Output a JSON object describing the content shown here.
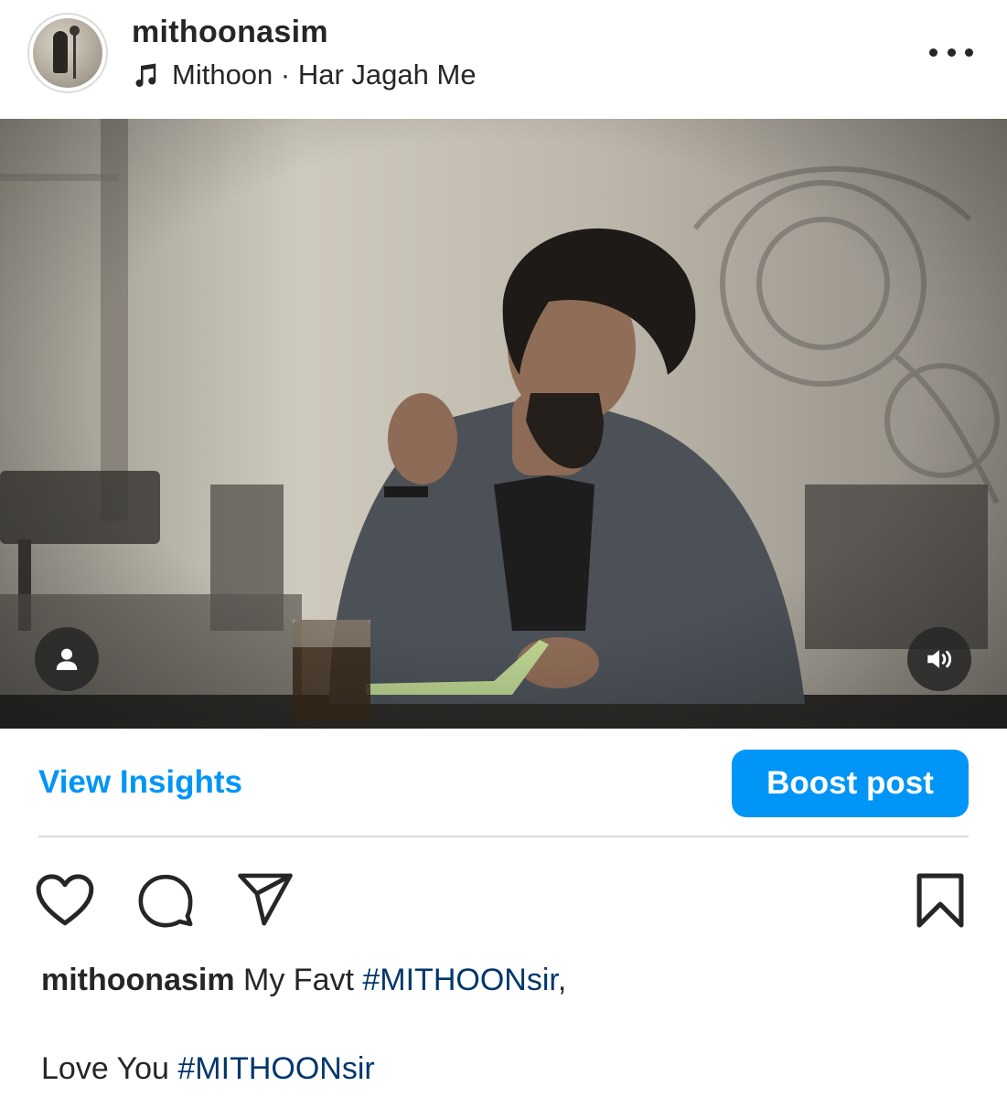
{
  "header": {
    "username": "mithoonasim",
    "music_artist": "Mithoon",
    "music_separator": " · ",
    "music_track": "Har Jagah Me",
    "music_icon": "music-note-icon",
    "more_icon": "more-options-icon"
  },
  "media": {
    "user_tag_icon": "person-icon",
    "sound_icon": "speaker-icon"
  },
  "actions": {
    "insights_label": "View Insights",
    "boost_label": "Boost post",
    "icons": [
      "heart-icon",
      "comment-icon",
      "share-icon",
      "bookmark-icon"
    ]
  },
  "caption": {
    "username": "mithoonasim",
    "text": "My Favt ",
    "hashtag1": "#MITHOONsir",
    "after_hashtag1": ",",
    "line2_text": "Love You ",
    "hashtag2": "#MITHOONsir"
  },
  "colors": {
    "accent": "#0095f6",
    "hashtag": "#00376b",
    "text": "#262626"
  }
}
